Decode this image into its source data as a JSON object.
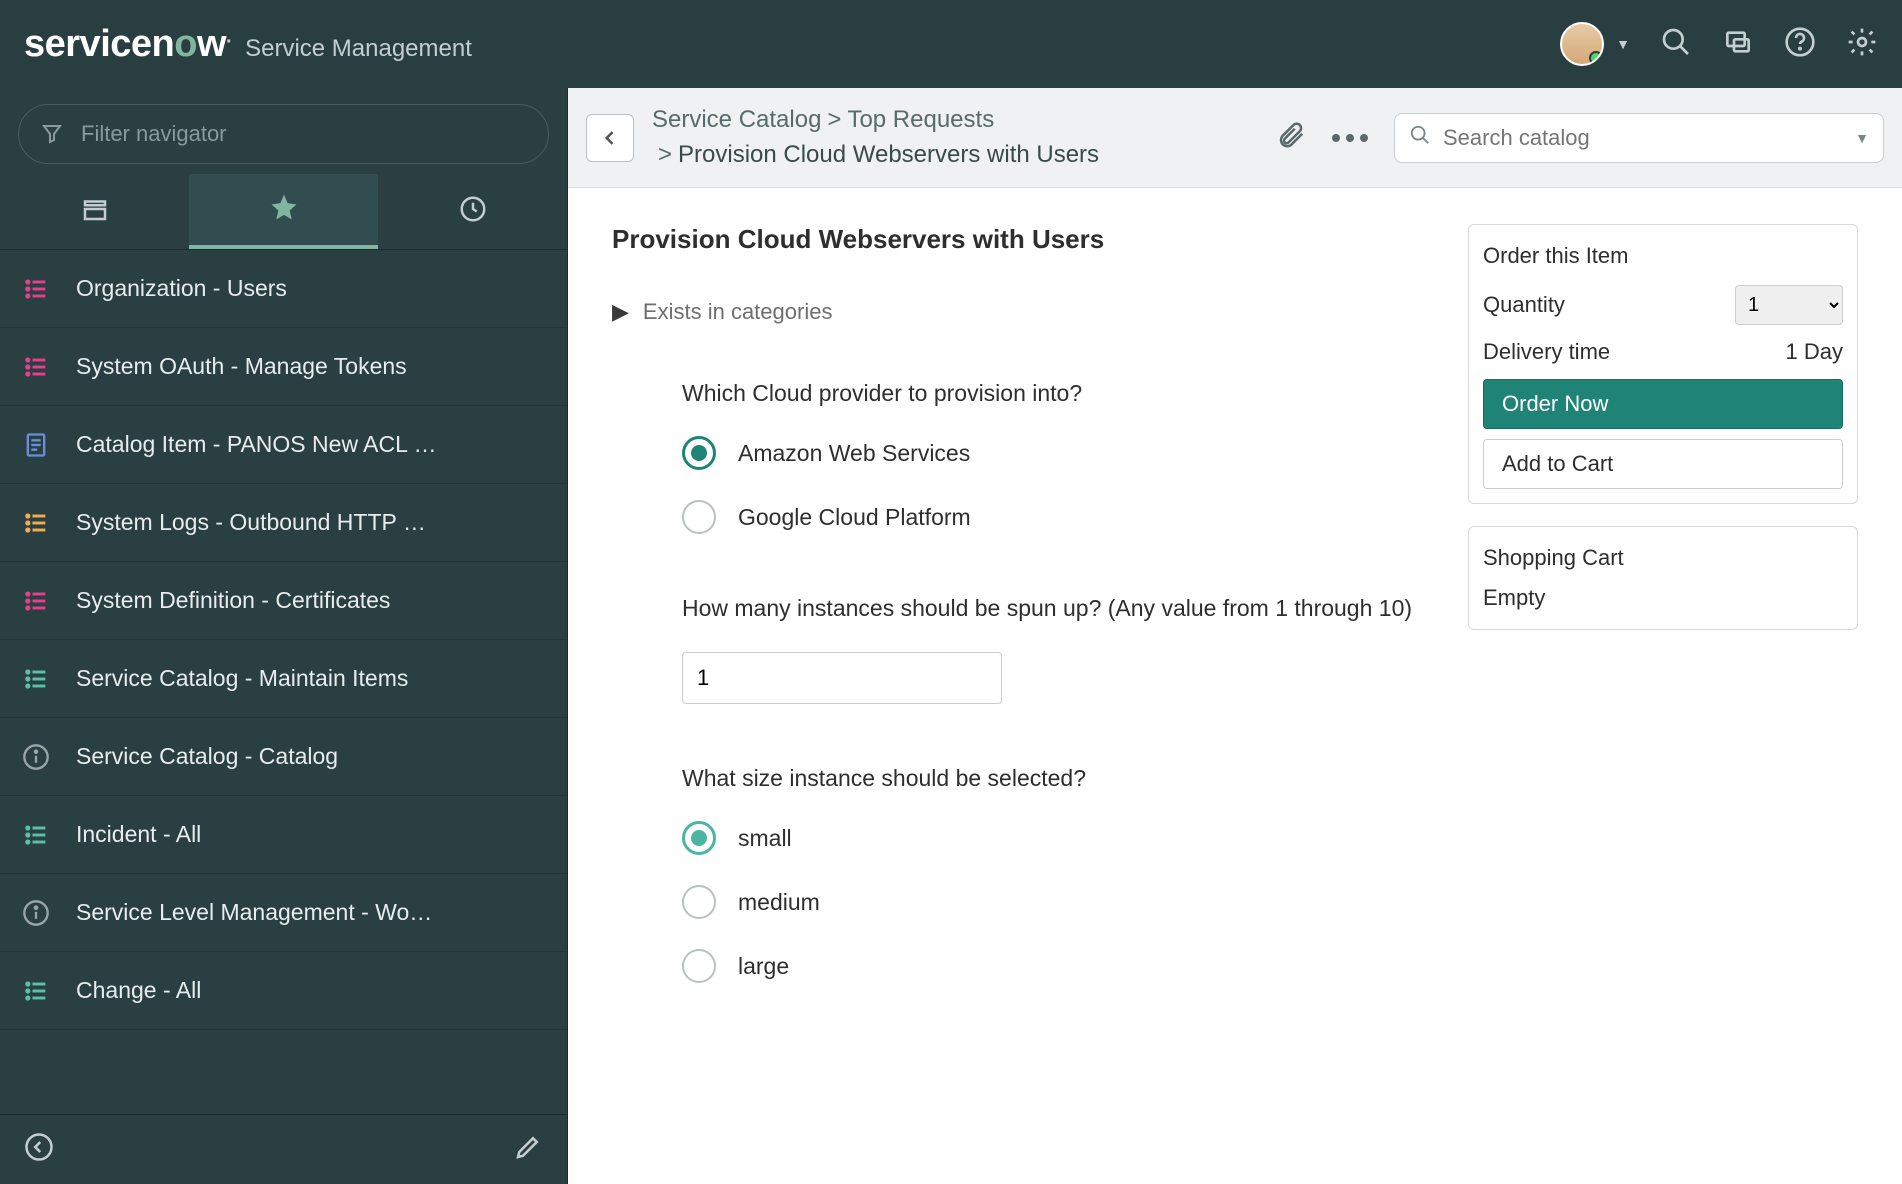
{
  "topbar": {
    "logo_sub": "Service Management"
  },
  "sidebar": {
    "filter_placeholder": "Filter navigator",
    "items": [
      {
        "label": "Organization - Users",
        "icon": "list",
        "color": "c-pink"
      },
      {
        "label": "System OAuth - Manage Tokens",
        "icon": "list",
        "color": "c-pink"
      },
      {
        "label": "Catalog Item - PANOS New ACL …",
        "icon": "doc",
        "color": "c-blue"
      },
      {
        "label": "System Logs - Outbound HTTP …",
        "icon": "list",
        "color": "c-orange"
      },
      {
        "label": "System Definition - Certificates",
        "icon": "list",
        "color": "c-pink"
      },
      {
        "label": "Service Catalog - Maintain Items",
        "icon": "list",
        "color": "c-teal"
      },
      {
        "label": "Service Catalog - Catalog",
        "icon": "info",
        "color": "c-grey"
      },
      {
        "label": "Incident - All",
        "icon": "list",
        "color": "c-teal"
      },
      {
        "label": "Service Level Management - Wo…",
        "icon": "info",
        "color": "c-grey"
      },
      {
        "label": "Change - All",
        "icon": "list",
        "color": "c-teal"
      }
    ]
  },
  "breadcrumb": {
    "parts": [
      "Service Catalog",
      "Top Requests",
      "Provision Cloud Webservers with Users"
    ],
    "search_placeholder": "Search catalog"
  },
  "form": {
    "title": "Provision Cloud Webservers with Users",
    "categories_toggle": "Exists in categories",
    "q1": {
      "label": "Which Cloud provider to provision into?",
      "options": [
        "Amazon Web Services",
        "Google Cloud Platform"
      ],
      "selected": 0
    },
    "q2": {
      "label": "How many instances should be spun up? (Any value from 1 through 10)",
      "value": "1"
    },
    "q3": {
      "label": "What size instance should be selected?",
      "options": [
        "small",
        "medium",
        "large"
      ],
      "selected": 0
    }
  },
  "order": {
    "title": "Order this Item",
    "qty_label": "Quantity",
    "qty_value": "1",
    "delivery_label": "Delivery time",
    "delivery_value": "1 Day",
    "order_now": "Order Now",
    "add_to_cart": "Add to Cart"
  },
  "cart": {
    "title": "Shopping Cart",
    "empty": "Empty"
  }
}
